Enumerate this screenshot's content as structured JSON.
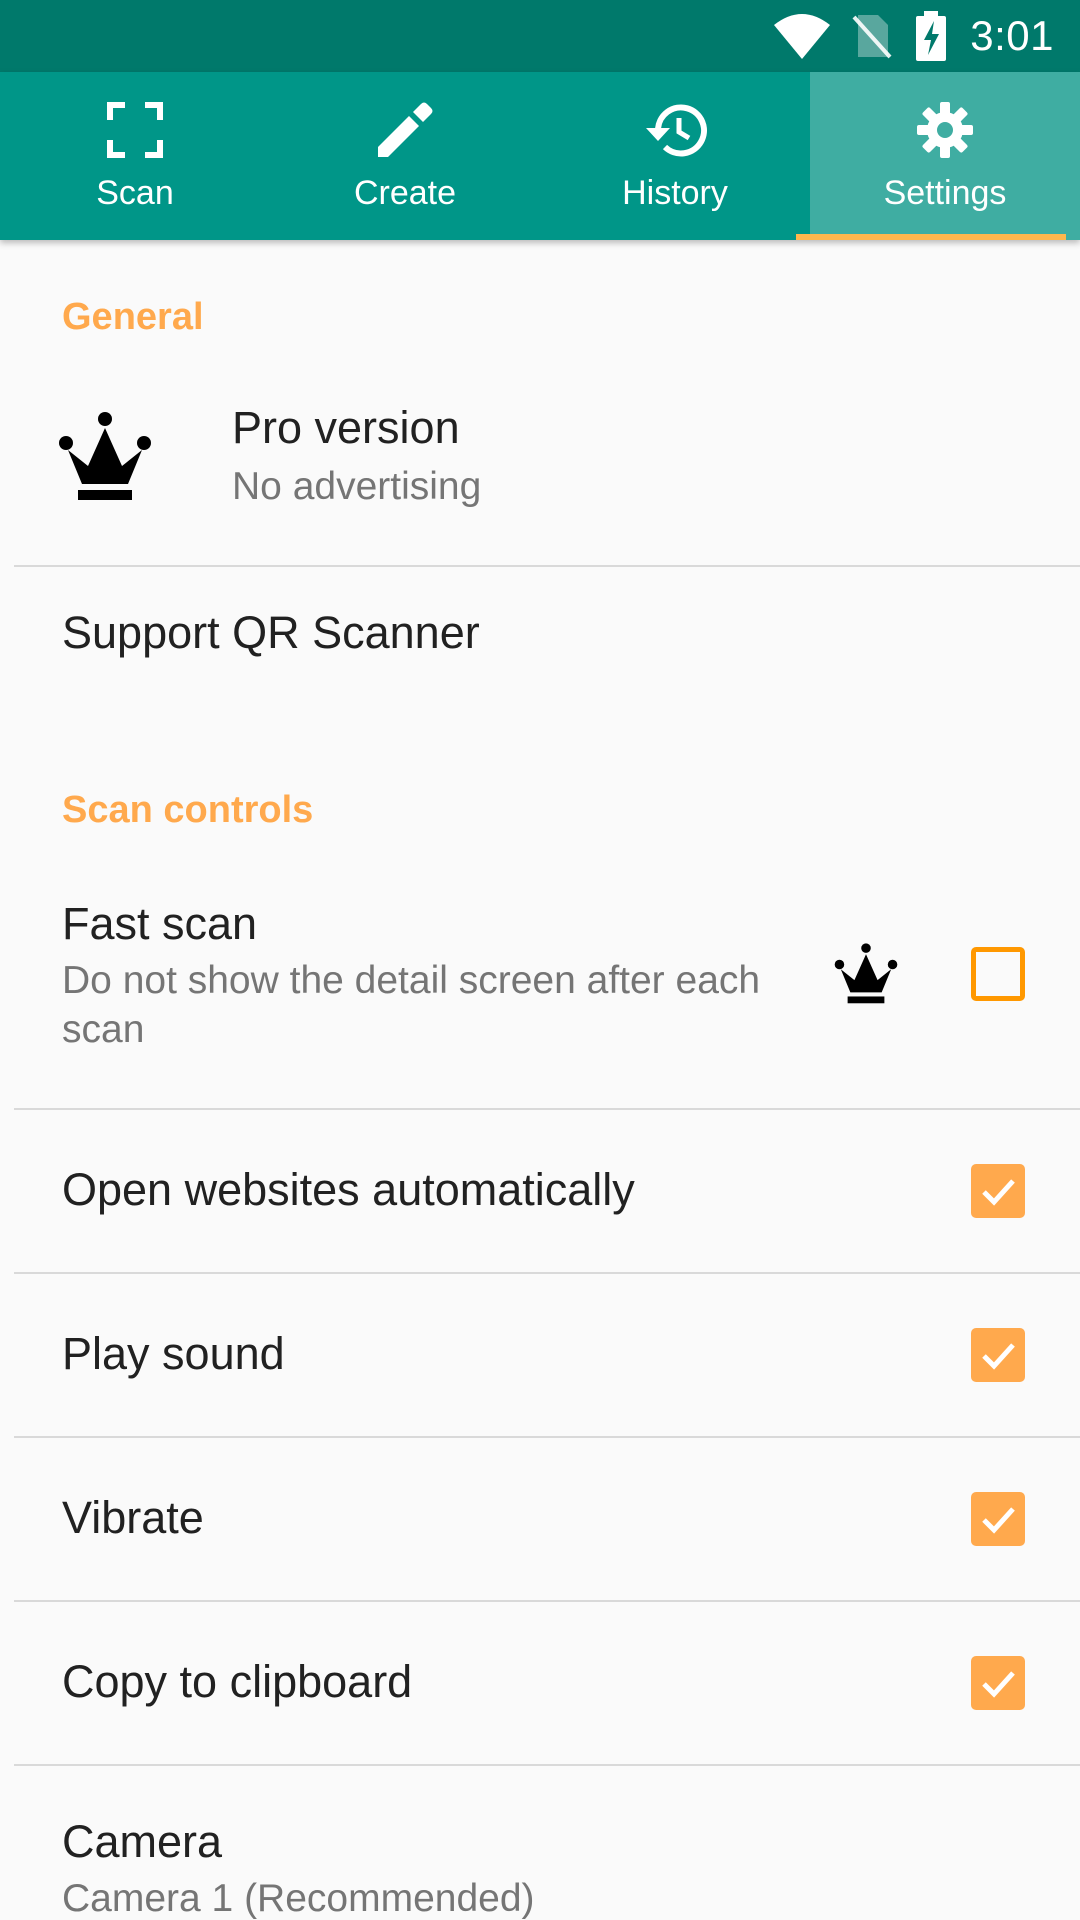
{
  "status_bar": {
    "time": "3:01",
    "icons": [
      "wifi-icon",
      "no-sim-icon",
      "battery-charging-icon"
    ]
  },
  "tabs": [
    {
      "label": "Scan",
      "icon": "scan-frame-icon",
      "active": false
    },
    {
      "label": "Create",
      "icon": "pencil-icon",
      "active": false
    },
    {
      "label": "History",
      "icon": "history-icon",
      "active": false
    },
    {
      "label": "Settings",
      "icon": "gear-icon",
      "active": true
    }
  ],
  "general": {
    "header": "General",
    "pro_version": {
      "title": "Pro version",
      "summary": "No advertising",
      "icon": "crown-icon"
    },
    "support": {
      "title": "Support QR Scanner"
    }
  },
  "scan_controls": {
    "header": "Scan controls",
    "fast_scan": {
      "title": "Fast scan",
      "summary": "Do not show the detail screen after each scan",
      "pro_icon": "crown-icon",
      "checked": false
    },
    "open_websites": {
      "title": "Open websites automatically",
      "checked": true
    },
    "play_sound": {
      "title": "Play sound",
      "checked": true
    },
    "vibrate": {
      "title": "Vibrate",
      "checked": true
    },
    "copy_clipboard": {
      "title": "Copy to clipboard",
      "checked": true
    },
    "camera": {
      "title": "Camera",
      "summary": "Camera 1 (Recommended)"
    }
  },
  "colors": {
    "status_bar": "#00796b",
    "tab_bar": "#009688",
    "tab_active": "#3fada2",
    "accent": "#ffa94d",
    "indicator": "#ffb74d"
  }
}
